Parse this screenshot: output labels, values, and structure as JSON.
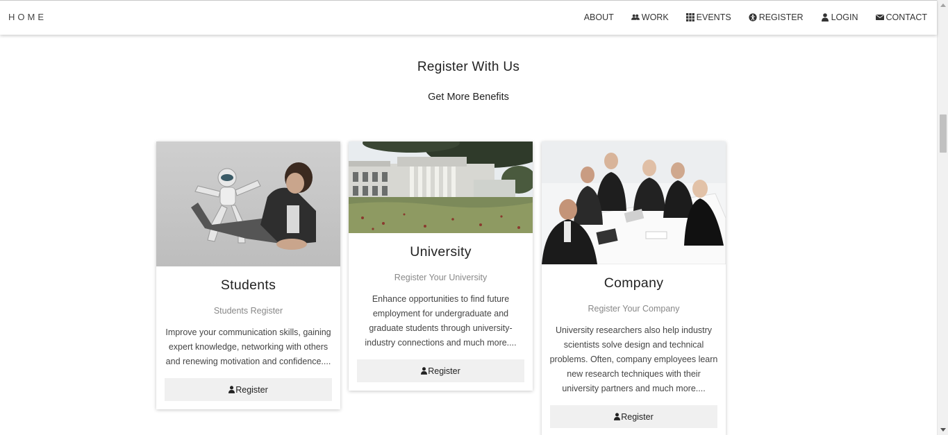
{
  "navbar": {
    "brand": "HOME",
    "items": [
      {
        "label": "ABOUT",
        "icon": "none"
      },
      {
        "label": "WORK",
        "icon": "users-icon"
      },
      {
        "label": "EVENTS",
        "icon": "grid-icon"
      },
      {
        "label": "REGISTER",
        "icon": "universal-access-icon"
      },
      {
        "label": "LOGIN",
        "icon": "user-icon"
      },
      {
        "label": "CONTACT",
        "icon": "envelope-icon"
      }
    ]
  },
  "section": {
    "title": "Register With Us",
    "subtitle": "Get More Benefits"
  },
  "cards": [
    {
      "title": "Students",
      "subtitle": "Students Register",
      "text": "Improve your communication skills, gaining expert knowledge, networking with others and renewing motivation and confidence....",
      "button": "Register",
      "image": "student-with-robot-photo"
    },
    {
      "title": "University",
      "subtitle": "Register Your University",
      "text": "Enhance opportunities to find future employment for undergraduate and graduate students through university-industry connections and much more....",
      "button": "Register",
      "image": "university-building-photo"
    },
    {
      "title": "Company",
      "subtitle": "Register Your Company",
      "text": "University researchers also help industry scientists solve design and technical problems. Often, company employees learn new research techniques with their university partners and much more....",
      "button": "Register",
      "image": "business-team-photo"
    }
  ]
}
